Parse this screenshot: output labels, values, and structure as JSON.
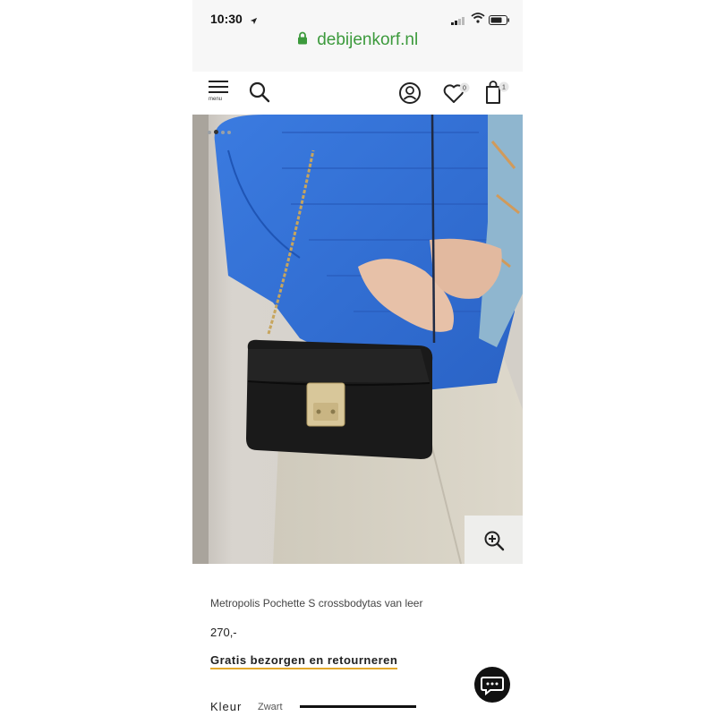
{
  "status_bar": {
    "time": "10:30"
  },
  "browser": {
    "url": "debijenkorf.nl"
  },
  "header": {
    "menu_label": "menu",
    "wishlist_count": "0",
    "bag_count": "1"
  },
  "gallery": {
    "slide_count": 4,
    "active_slide": 2
  },
  "product": {
    "title": "Metropolis Pochette S crossbodytas van leer",
    "price": "270,-",
    "shipping_link": "Gratis bezorgen en retourneren",
    "color_label": "Kleur",
    "color_value": "Zwart"
  },
  "colors": {
    "url_green": "#3c9a3c",
    "accent_underline": "#e3a82b",
    "jacket_blue": "#2f6fd6",
    "bag_black": "#1a1a1a"
  },
  "icons": [
    "location-arrow-icon",
    "signal-icon",
    "wifi-icon",
    "battery-icon",
    "lock-icon",
    "menu-icon",
    "search-icon",
    "account-icon",
    "heart-icon",
    "shopping-bag-icon",
    "zoom-in-icon",
    "chat-icon"
  ]
}
